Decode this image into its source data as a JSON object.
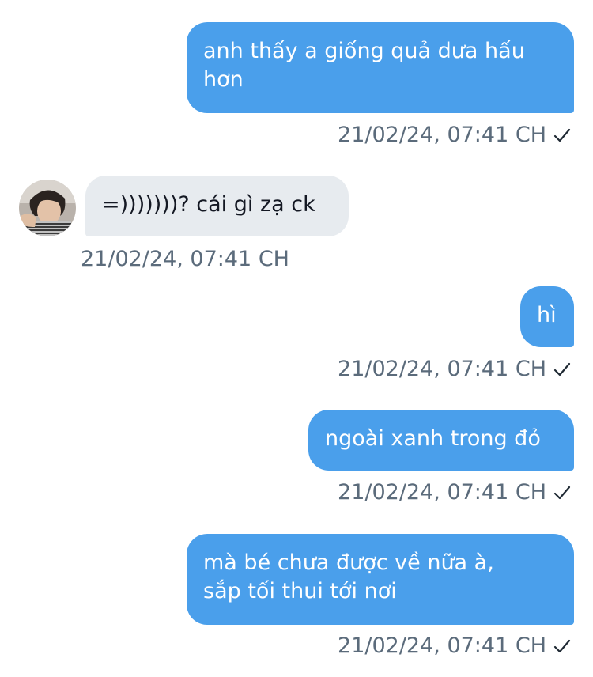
{
  "messages": [
    {
      "direction": "sent",
      "text": "anh thấy a giống quả dưa hấu\nhơn",
      "timestamp": "21/02/24, 07:41 CH",
      "status_icon": "checkmark-icon"
    },
    {
      "direction": "received",
      "text": "=)))))))? cái gì zạ ck",
      "timestamp": "21/02/24, 07:41 CH",
      "avatar_icon": "contact-avatar"
    },
    {
      "direction": "sent",
      "text": "hì",
      "timestamp": "21/02/24, 07:41 CH",
      "status_icon": "checkmark-icon"
    },
    {
      "direction": "sent",
      "text": "ngoài xanh trong đỏ",
      "timestamp": "21/02/24, 07:41 CH",
      "status_icon": "checkmark-icon"
    },
    {
      "direction": "sent",
      "text": "mà bé chưa được về nữa à,\nsắp tối thui tới nơi",
      "timestamp": "21/02/24, 07:41 CH",
      "status_icon": "checkmark-icon"
    }
  ],
  "colors": {
    "sent_bubble": "#4a9feb",
    "received_bubble": "#e7ebef",
    "timestamp_text": "#5b6b7b"
  }
}
